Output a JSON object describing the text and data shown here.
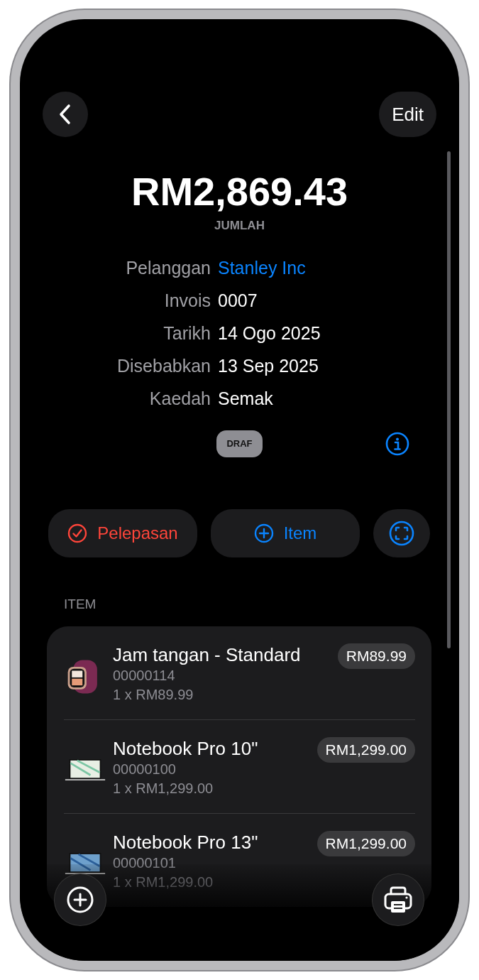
{
  "nav": {
    "edit_label": "Edit"
  },
  "amount": "RM2,869.43",
  "amount_label": "JUMLAH",
  "details": [
    {
      "label": "Pelanggan",
      "value": "Stanley Inc",
      "kind": "link"
    },
    {
      "label": "Invois",
      "value": "0007",
      "kind": "text"
    },
    {
      "label": "Tarikh",
      "value": "14 Ogo 2025",
      "kind": "text"
    },
    {
      "label": "Disebabkan",
      "value": "13 Sep 2025",
      "kind": "text"
    },
    {
      "label": "Kaedah",
      "value": "Semak",
      "kind": "text"
    }
  ],
  "status_badge": "DRAF",
  "actions": [
    {
      "kind": "mark_paid",
      "label": "Pelepasan"
    },
    {
      "kind": "add_item",
      "label": "Item"
    },
    {
      "kind": "scan"
    }
  ],
  "section_header": "ITEM",
  "items": [
    {
      "kind": "watch",
      "name": "Jam tangan - Standard",
      "sku": "00000114",
      "quantity_line": "1 x RM89.99",
      "price": "RM89.99"
    },
    {
      "kind": "laptop",
      "name": "Notebook Pro 10\"",
      "sku": "00000100",
      "quantity_line": "1 x RM1,299.00",
      "price": "RM1,299.00"
    },
    {
      "kind": "laptop",
      "name": "Notebook Pro 13\"",
      "sku": "00000101",
      "quantity_line": "1 x RM1,299.00",
      "price": "RM1,299.00"
    }
  ]
}
